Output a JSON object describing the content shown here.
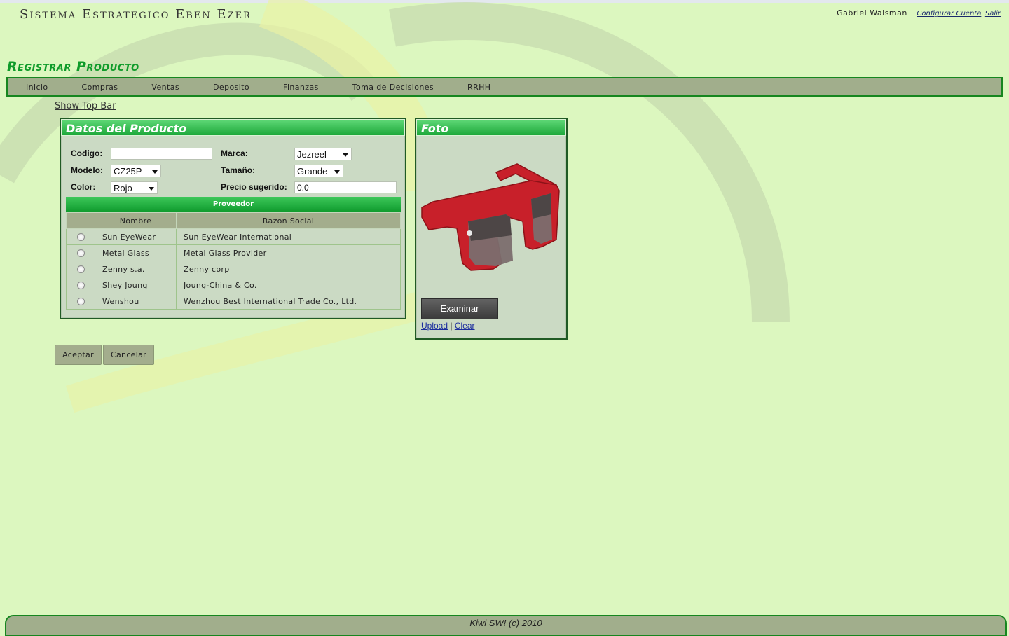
{
  "app": {
    "title": "Sistema Estrategico Eben Ezer"
  },
  "user": {
    "name": "Gabriel Waisman",
    "config_label": "Configurar Cuenta",
    "logout_label": "Salir"
  },
  "page": {
    "title": "Registrar Producto",
    "show_top_bar": "Show Top Bar"
  },
  "menu": {
    "items": [
      "Inicio",
      "Compras",
      "Ventas",
      "Deposito",
      "Finanzas",
      "Toma de Decisiones",
      "RRHH"
    ]
  },
  "datos": {
    "title": "Datos del Producto",
    "codigo_label": "Codigo:",
    "codigo_value": "",
    "marca_label": "Marca:",
    "marca_value": "Jezreel",
    "modelo_label": "Modelo:",
    "modelo_value": "CZ25P",
    "tamano_label": "Tamaño:",
    "tamano_value": "Grande",
    "color_label": "Color:",
    "color_value": "Rojo",
    "precio_label": "Precio sugerido:",
    "precio_value": "0.0"
  },
  "proveedor": {
    "title": "Proveedor",
    "columns": [
      "Nombre",
      "Razon Social"
    ],
    "rows": [
      {
        "nombre": "Sun EyeWear",
        "razon": "Sun EyeWear International"
      },
      {
        "nombre": "Metal Glass",
        "razon": "Metal Glass Provider"
      },
      {
        "nombre": "Zenny s.a.",
        "razon": "Zenny corp"
      },
      {
        "nombre": "Shey Joung",
        "razon": "Joung-China & Co."
      },
      {
        "nombre": "Wenshou",
        "razon": "Wenzhou Best International Trade Co., Ltd."
      }
    ]
  },
  "foto": {
    "title": "Foto",
    "browse_label": "Examinar",
    "upload_label": "Upload",
    "separator": "|",
    "clear_label": "Clear"
  },
  "actions": {
    "accept_label": "Aceptar",
    "cancel_label": "Cancelar"
  },
  "footer": {
    "text": "Kiwi SW! (c) 2010"
  },
  "colors": {
    "background": "#dcf7bf",
    "accent_green": "#0f9b2a",
    "bar_gray": "#a1ae8c",
    "panel_bg": "#cbdac4",
    "product_red": "#c8202a"
  }
}
